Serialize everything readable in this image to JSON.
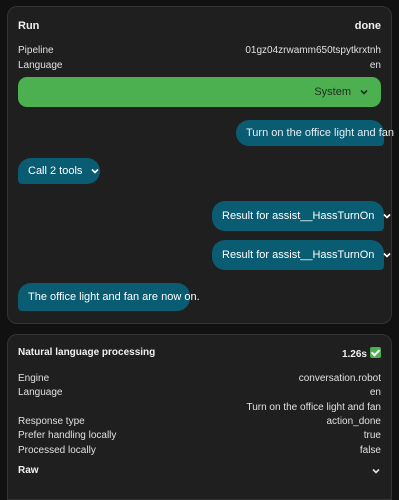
{
  "run": {
    "title": "Run",
    "status": "done",
    "rows": [
      {
        "label": "Pipeline",
        "value": "01gz04zrwamm650tspytkrxtnh"
      },
      {
        "label": "Language",
        "value": "en"
      }
    ],
    "system_label": "System",
    "messages": {
      "user_utterance": "Turn on the office light and fan",
      "tool_call": "Call 2 tools",
      "result_1": "Result for assist__HassTurnOn",
      "result_2": "Result for assist__HassTurnOn",
      "assistant_reply": "The office light and fan are now on."
    }
  },
  "nlp": {
    "title": "Natural language processing",
    "duration": "1.26s",
    "rows": [
      {
        "label": "Engine",
        "value": "conversation.robot"
      },
      {
        "label": "Language",
        "value": "en"
      },
      {
        "label": "",
        "value": "Turn on the office light and fan"
      },
      {
        "label": "Response type",
        "value": "action_done"
      },
      {
        "label": "Prefer handling locally",
        "value": "true"
      },
      {
        "label": "Processed locally",
        "value": "false"
      }
    ],
    "raw_label": "Raw"
  },
  "colors": {
    "system_bar": "#4caf50",
    "bubble": "#0a5c73",
    "card": "#1f1f1f",
    "background": "#111111"
  },
  "icons": {
    "chevron": "chevron-down-icon",
    "check": "check-icon"
  }
}
